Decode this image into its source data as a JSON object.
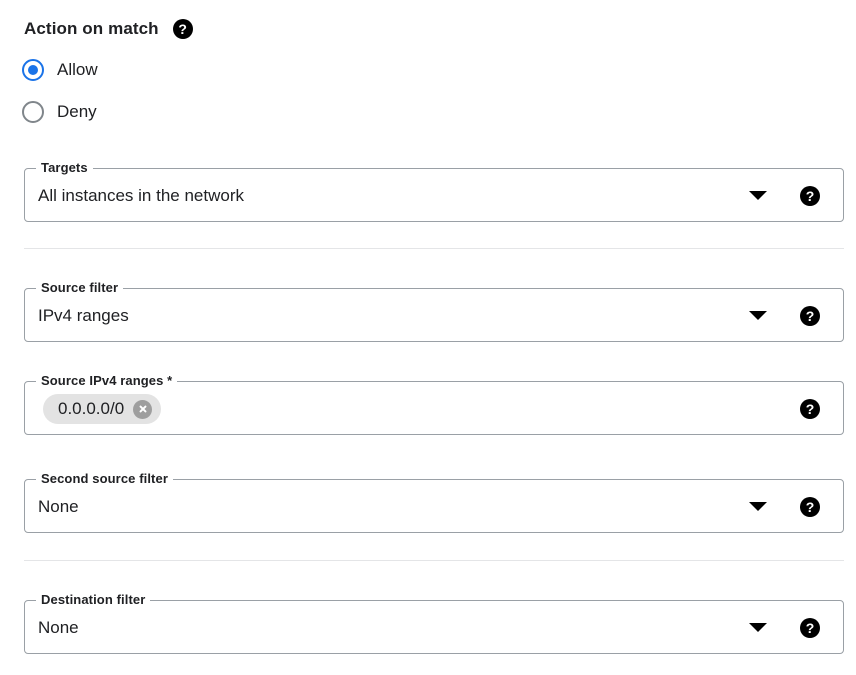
{
  "section": {
    "title": "Action on match",
    "help_icon": "help-icon",
    "help_glyph": "?"
  },
  "action_options": [
    {
      "label": "Allow",
      "selected": true
    },
    {
      "label": "Deny",
      "selected": false
    }
  ],
  "fields": [
    {
      "id": "targets",
      "label": "Targets",
      "value": "All instances in the network",
      "type": "select",
      "caret_icon": "chevron-down-icon",
      "help_icon": "help-icon"
    },
    {
      "id": "source-filter",
      "label": "Source filter",
      "value": "IPv4 ranges",
      "type": "select",
      "caret_icon": "chevron-down-icon",
      "help_icon": "help-icon"
    },
    {
      "id": "source-ranges",
      "label": "Source IPv4 ranges *",
      "value": "",
      "type": "chips",
      "chips": [
        {
          "text": "0.0.0.0/0",
          "remove_icon": "close-circle-icon"
        }
      ],
      "help_icon": "help-icon"
    },
    {
      "id": "second-source",
      "label": "Second source filter",
      "value": "None",
      "type": "select",
      "caret_icon": "chevron-down-icon",
      "help_icon": "help-icon"
    },
    {
      "id": "destination",
      "label": "Destination filter",
      "value": "None",
      "type": "select",
      "caret_icon": "chevron-down-icon",
      "help_icon": "help-icon"
    }
  ],
  "colors": {
    "accent_blue": "#1a73e8",
    "field_border": "#9aa0a6",
    "divider": "#e4e5e7",
    "chip_bg": "#e3e3e3",
    "chip_remove": "#9e9e9e",
    "text": "#202124",
    "help_bg": "#000000"
  }
}
